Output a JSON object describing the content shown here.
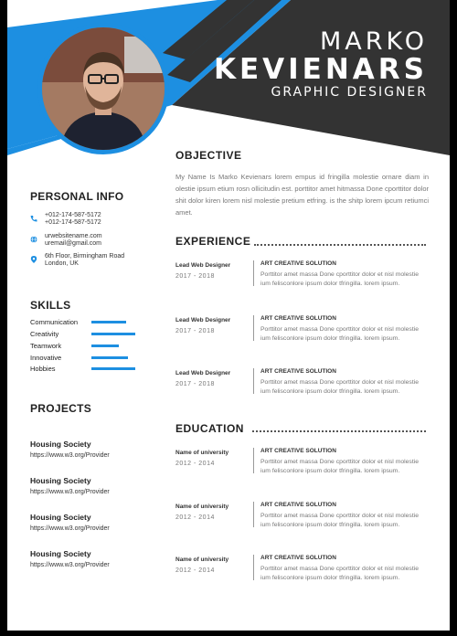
{
  "header": {
    "first_name": "MARKO",
    "last_name": "KEVIENARS",
    "role": "GRAPHIC DESIGNER",
    "accent_color": "#1d8fe1",
    "dark_color": "#333333"
  },
  "personal_info": {
    "title": "PERSONAL INFO",
    "phone_1": "+012-174-587-5172",
    "phone_2": "+012-174-587-5172",
    "website": "urwebsitename.com",
    "email": "uremail@gmail.com",
    "address_1": "6th Floor, Birmingham Road",
    "address_2": "London, UK"
  },
  "skills": {
    "title": "SKILLS",
    "items": [
      {
        "label": "Communication",
        "level": 0.75
      },
      {
        "label": "Creativity",
        "level": 0.95
      },
      {
        "label": "Teamwork",
        "level": 0.6
      },
      {
        "label": "Innovative",
        "level": 0.8
      },
      {
        "label": "Hobbies",
        "level": 0.95
      }
    ]
  },
  "projects": {
    "title": "PROJECTS",
    "items": [
      {
        "name": "Housing Society",
        "url": "https://www.w3.org/Provider"
      },
      {
        "name": "Housing Society",
        "url": "https://www.w3.org/Provider"
      },
      {
        "name": "Housing Society",
        "url": "https://www.w3.org/Provider"
      },
      {
        "name": "Housing Society",
        "url": "https://www.w3.org/Provider"
      }
    ]
  },
  "objective": {
    "title": "OBJECTIVE",
    "text": "My Name Is Marko Kevienars lorem empus id fringilla molestie ornare diam in olestie ipsum etium rosn ollicitudin est. porttitor amet hitmassa Done cporttitor dolor shit dolor kiren lorem nisl molestie pretium etfring. is the shitp lorem ipcum retiumci amet."
  },
  "experience": {
    "title": "EXPERIENCE",
    "items": [
      {
        "position": "Lead  Web Designer",
        "dates": "2017 - 2018",
        "company": "ART CREATIVE SOLUTION",
        "desc": "Porttitor amet massa Done cporttitor dolor et nisl molestie ium felisconlore ipsum dolor tfringilla. lorem ipsum."
      },
      {
        "position": "Lead  Web Designer",
        "dates": "2017 - 2018",
        "company": "ART CREATIVE SOLUTION",
        "desc": "Porttitor amet massa Done cporttitor dolor et nisl molestie ium felisconlore ipsum dolor tfringilla. lorem ipsum."
      },
      {
        "position": "Lead  Web Designer",
        "dates": "2017 - 2018",
        "company": "ART CREATIVE SOLUTION",
        "desc": "Porttitor amet massa Done cporttitor dolor et nisl molestie ium felisconlore ipsum dolor tfringilla. lorem ipsum."
      }
    ]
  },
  "education": {
    "title": "EDUCATION",
    "items": [
      {
        "school": "Name of university",
        "dates": "2012 - 2014",
        "company": "ART CREATIVE SOLUTION",
        "desc": "Porttitor amet massa Done cporttitor dolor et nisl molestie ium felisconlore ipsum dolor tfringilla. lorem ipsum."
      },
      {
        "school": "Name of university",
        "dates": "2012 - 2014",
        "company": "ART CREATIVE SOLUTION",
        "desc": "Porttitor amet massa Done cporttitor dolor et nisl molestie ium felisconlore ipsum dolor tfringilla. lorem ipsum."
      },
      {
        "school": "Name of university",
        "dates": "2012 - 2014",
        "company": "ART CREATIVE SOLUTION",
        "desc": "Porttitor amet massa Done cporttitor dolor et nisl molestie ium felisconlore ipsum dolor tfringilla. lorem ipsum."
      }
    ]
  }
}
